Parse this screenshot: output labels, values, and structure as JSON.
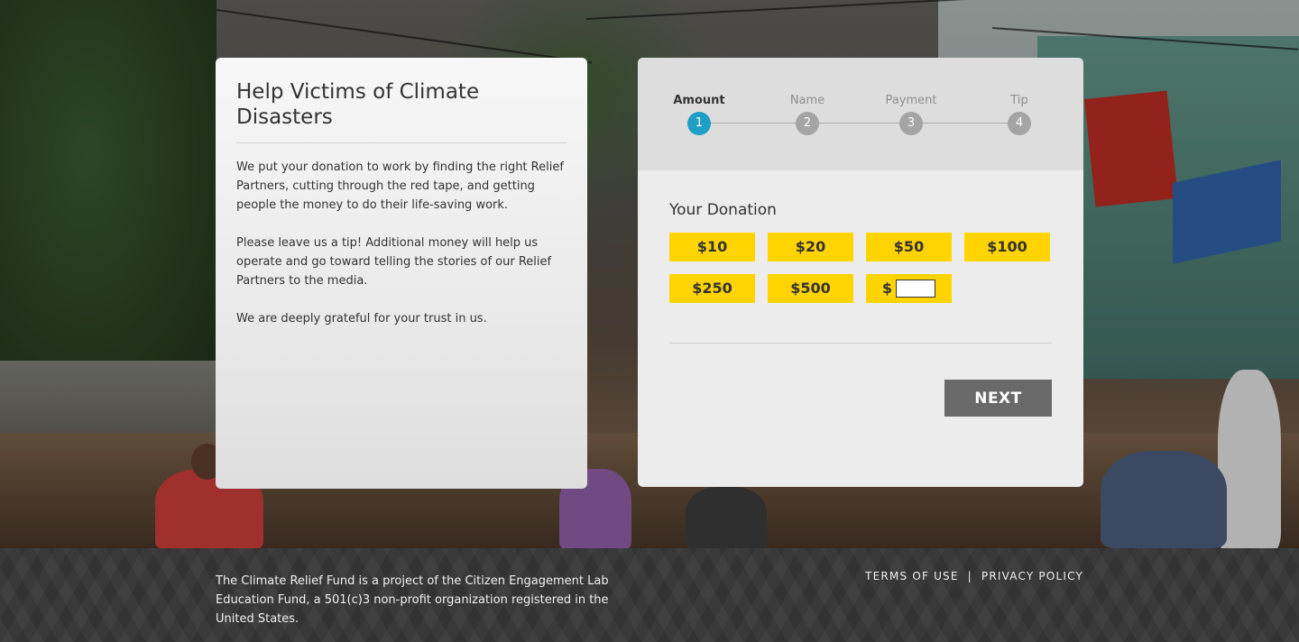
{
  "info": {
    "title": "Help Victims of Climate Disasters",
    "paragraphs": [
      "We put your donation to work by finding the right Relief Partners, cutting through the red tape, and getting people the money to do their life-saving work.",
      "Please leave us a tip! Additional money will help us operate and go toward telling the stories of our Relief Partners to the media.",
      "We are deeply grateful for your trust in us."
    ]
  },
  "steps": [
    {
      "label": "Amount",
      "number": "1",
      "active": true
    },
    {
      "label": "Name",
      "number": "2",
      "active": false
    },
    {
      "label": "Payment",
      "number": "3",
      "active": false
    },
    {
      "label": "Tip",
      "number": "4",
      "active": false
    }
  ],
  "donation": {
    "heading": "Your Donation",
    "amounts": [
      "$10",
      "$20",
      "$50",
      "$100",
      "$250",
      "$500"
    ],
    "custom_prefix": "$",
    "custom_value": "",
    "next_label": "NEXT"
  },
  "colors": {
    "amount_button": "#ffd400",
    "active_step": "#1f9fc6",
    "inactive_step": "#a4a4a4",
    "next_button": "#6a6a6a"
  },
  "footer": {
    "text": "The Climate Relief Fund is a project of the Citizen Engagement Lab Education Fund, a 501(c)3 non-profit organization registered in the United States.",
    "terms_label": "TERMS OF USE",
    "separator": "|",
    "privacy_label": "PRIVACY POLICY"
  }
}
